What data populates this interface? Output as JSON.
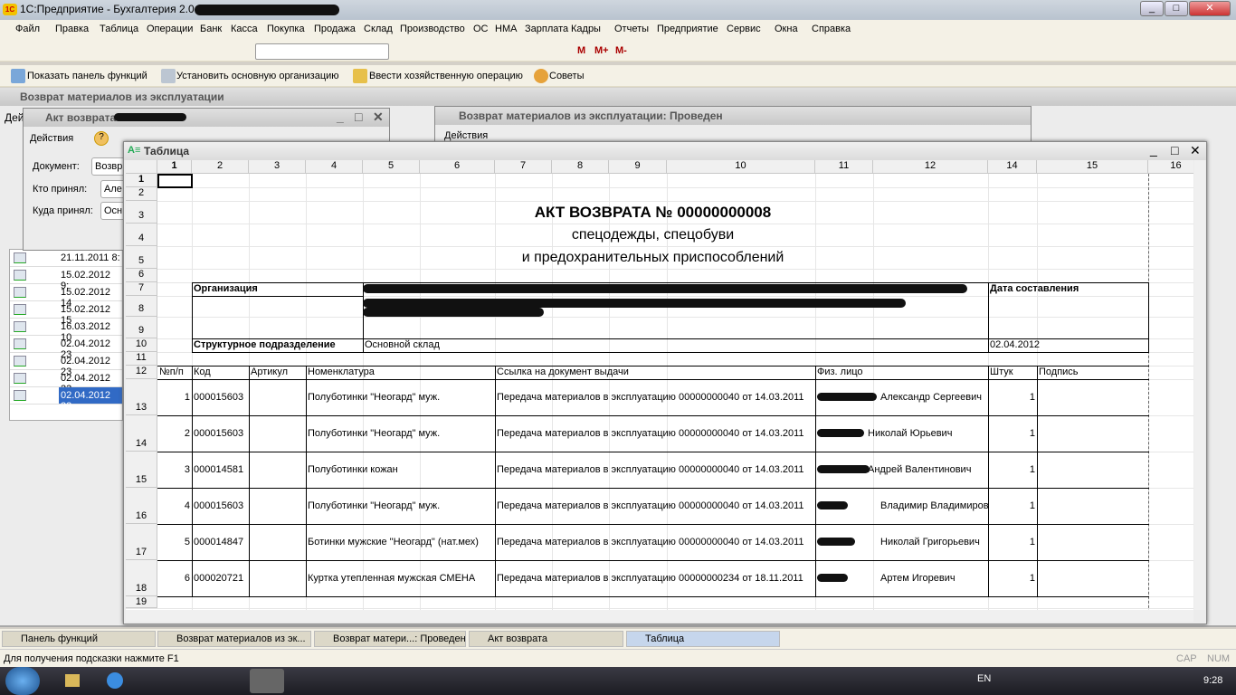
{
  "window": {
    "title": "1С:Предприятие - Бухгалтерия 2.0",
    "controls": [
      "_",
      "□",
      "✕"
    ]
  },
  "menu": [
    "Файл",
    "Правка",
    "Таблица",
    "Операции",
    "Банк",
    "Касса",
    "Покупка",
    "Продажа",
    "Склад",
    "Производство",
    "ОС",
    "НМА",
    "Зарплата",
    "Кадры",
    "Отчеты",
    "Предприятие",
    "Сервис",
    "Окна",
    "Справка"
  ],
  "toolbar": {
    "m": "M",
    "mplus": "M+",
    "mminus": "M-",
    "search_value": ""
  },
  "toolbar2": {
    "show_panel": "Показать панель функций",
    "set_org": "Установить основную организацию",
    "enter_op": "Ввести хозяйственную операцию",
    "tips": "Советы"
  },
  "list_window": {
    "title": "Возврат материалов из эксплуатации",
    "actions": "Дей",
    "dates": [
      "21.11.2011 8:",
      "15.02.2012 9:",
      "15.02.2012 14",
      "15.02.2012 15",
      "16.03.2012 10",
      "02.04.2012 23",
      "02.04.2012 23",
      "02.04.2012 23",
      "02.04.2012 23"
    ]
  },
  "act_window": {
    "title": "Акт возврата",
    "actions": "Действия",
    "doc_label": "Документ:",
    "doc_value": "Возвр",
    "who_label": "Кто принял:",
    "who_value": "Але",
    "where_label": "Куда принял:",
    "where_value": "Осн"
  },
  "posted_window": {
    "title": "Возврат материалов из эксплуатации: Проведен",
    "actions": "Действия"
  },
  "table_window": {
    "title": "Таблица"
  },
  "sheet": {
    "col_headers": [
      "1",
      "2",
      "3",
      "4",
      "5",
      "6",
      "7",
      "8",
      "9",
      "10",
      "11",
      "12",
      "14",
      "15",
      "16"
    ],
    "row_headers": [
      "1",
      "2",
      "3",
      "4",
      "5",
      "6",
      "7",
      "8",
      "9",
      "10",
      "11",
      "12",
      "13",
      "14",
      "15",
      "16",
      "17",
      "18",
      "19"
    ],
    "doc_title": "АКТ ВОЗВРАТА № 00000000008",
    "subtitle1": "спецодежды, спецобуви",
    "subtitle2": "и предохранительных приспособлений",
    "org_label": "Организация",
    "date_label": "Дата составления",
    "dept_label": "Структурное подразделение",
    "dept_value": "Основной склад",
    "date_value": "02.04.2012",
    "columns": [
      "№п/п",
      "Код",
      "Артикул",
      "Номенклатура",
      "Ссылка на документ выдачи",
      "Физ. лицо",
      "Штук",
      "Подпись"
    ],
    "rows": [
      [
        "1",
        "000015603",
        "",
        "Полуботинки \"Неогард\" муж.",
        "Передача материалов в эксплуатацию 00000000040 от 14.03.2011",
        "Александр Сергеевич",
        "1",
        ""
      ],
      [
        "2",
        "000015603",
        "",
        "Полуботинки \"Неогард\" муж.",
        "Передача материалов в эксплуатацию 00000000040 от 14.03.2011",
        "Николай Юрьевич",
        "1",
        ""
      ],
      [
        "3",
        "000014581",
        "",
        "Полуботинки кожан",
        "Передача материалов в эксплуатацию 00000000040 от 14.03.2011",
        "Андрей Валентинович",
        "1",
        ""
      ],
      [
        "4",
        "000015603",
        "",
        "Полуботинки \"Неогард\" муж.",
        "Передача материалов в эксплуатацию 00000000040 от 14.03.2011",
        "Владимир Владимирович",
        "1",
        ""
      ],
      [
        "5",
        "000014847",
        "",
        "Ботинки мужские \"Неогард\" (нат.мех)",
        "Передача материалов в эксплуатацию 00000000040 от 14.03.2011",
        "Николай Григорьевич",
        "1",
        ""
      ],
      [
        "6",
        "000020721",
        "",
        "Куртка утепленная мужская СМЕНА",
        "Передача материалов в эксплуатацию 00000000234 от 18.11.2011",
        "Артем Игоревич",
        "1",
        ""
      ]
    ]
  },
  "window_tabs": [
    "Панель функций",
    "Возврат материалов из эк...",
    "Возврат матери...: Проведен",
    "Акт возврата",
    "Таблица"
  ],
  "status": {
    "hint": "Для получения подсказки нажмите F1",
    "cap": "CAP",
    "num": "NUM"
  },
  "os_taskbar": {
    "lang": "EN",
    "time": "9:28"
  },
  "colors": {
    "selection": "#316ac5",
    "mdi_bg": "#a9a9a9",
    "panel": "#f4f1e6"
  }
}
